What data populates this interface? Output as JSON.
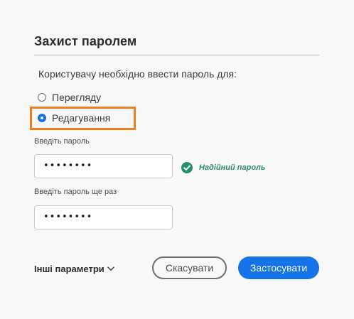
{
  "dialog": {
    "title": "Захист паролем",
    "prompt": "Користувачу необхідно ввести пароль для:",
    "options": {
      "view": "Перегляду",
      "edit": "Редагування",
      "selected": "edit"
    },
    "password_label": "Введіть пароль",
    "password_value": "••••••••",
    "confirm_label": "Введіть пароль ще раз",
    "confirm_value": "••••••••",
    "strength_text": "Надійний пароль",
    "more_options": "Інші параметри",
    "cancel_label": "Скасувати",
    "apply_label": "Застосувати"
  },
  "colors": {
    "accent": "#1473e6",
    "success": "#268e6c",
    "highlight": "#ef7f1a"
  },
  "icons": {
    "strength": "check-circle-icon",
    "more": "chevron-down-icon"
  }
}
